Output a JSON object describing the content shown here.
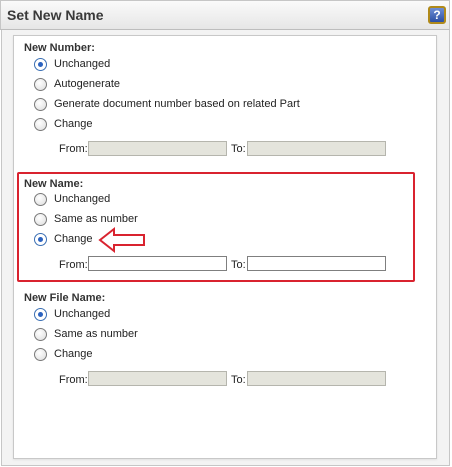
{
  "dialog": {
    "title": "Set New Name",
    "help_icon": "help-question-icon",
    "help_glyph": "?"
  },
  "new_number": {
    "label": "New Number:",
    "options": [
      {
        "label": "Unchanged",
        "checked": true
      },
      {
        "label": "Autogenerate",
        "checked": false
      },
      {
        "label": "Generate document number based on related Part",
        "checked": false
      },
      {
        "label": "Change",
        "checked": false
      }
    ],
    "from_label": "From:",
    "to_label": "To:",
    "from_value": "",
    "to_value": "",
    "fields_enabled": false
  },
  "new_name": {
    "label": "New Name:",
    "options": [
      {
        "label": "Unchanged",
        "checked": false
      },
      {
        "label": "Same as number",
        "checked": false
      },
      {
        "label": "Change",
        "checked": true
      }
    ],
    "from_label": "From:",
    "to_label": "To:",
    "from_value": "",
    "to_value": "",
    "fields_enabled": true
  },
  "new_file_name": {
    "label": "New File Name:",
    "options": [
      {
        "label": "Unchanged",
        "checked": true
      },
      {
        "label": "Same as number",
        "checked": false
      },
      {
        "label": "Change",
        "checked": false
      }
    ],
    "from_label": "From:",
    "to_label": "To:",
    "from_value": "",
    "to_value": "",
    "fields_enabled": false
  },
  "annotation": {
    "highlight_color": "#d9232f",
    "arrow_icon": "left-arrow-annotation-icon"
  }
}
